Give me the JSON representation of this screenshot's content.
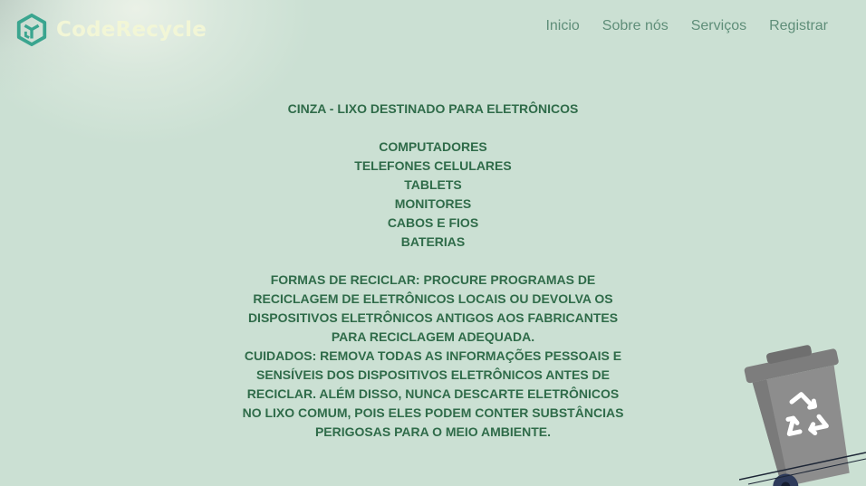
{
  "brand": {
    "name": "CodeRecycle",
    "logo_icon": "recycle-cube-icon",
    "name_color": "#f2f6d6",
    "icon_color": "#3aa58f"
  },
  "nav": {
    "items": [
      {
        "label": "Inicio"
      },
      {
        "label": "Sobre nós"
      },
      {
        "label": "Serviços"
      },
      {
        "label": "Registrar"
      }
    ]
  },
  "content": {
    "title": "Cinza - Lixo destinado para eletrônicos",
    "items": [
      "Computadores",
      "Telefones celulares",
      "Tablets",
      "Monitores",
      "Cabos e fios",
      "Baterias"
    ],
    "recycle_text": "Formas de reciclar: Procure programas de reciclagem de eletrônicos locais ou devolva os dispositivos eletrônicos antigos aos fabricantes para reciclagem adequada.",
    "care_text": "Cuidados: Remova todas as informações pessoais e sensíveis dos dispositivos eletrônicos antes de reciclar. Além disso, nunca descarte eletrônicos no lixo comum, pois eles podem conter substâncias perigosas para o meio ambiente."
  },
  "illustration": {
    "icon": "gray-recycle-bin-icon",
    "bin_color": "#8a8a8a"
  },
  "colors": {
    "background": "#cbe0d3",
    "text": "#2f6b49",
    "nav": "#5f8e79"
  }
}
